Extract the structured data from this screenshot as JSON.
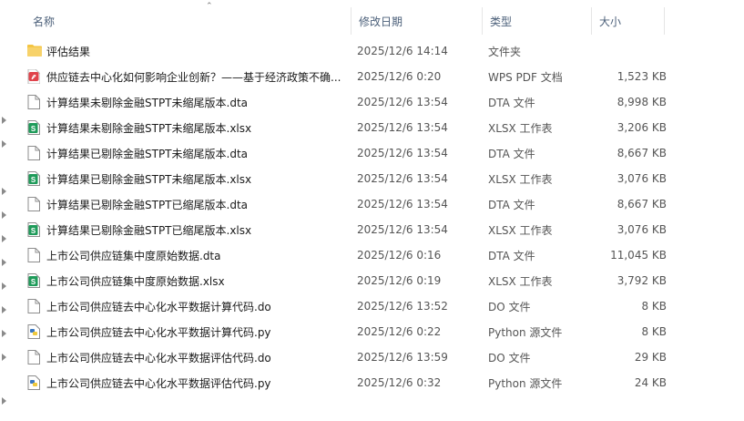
{
  "columns": {
    "name": "名称",
    "date": "修改日期",
    "type": "类型",
    "size": "大小"
  },
  "files": [
    {
      "icon": "folder-icon",
      "name": "评估结果",
      "date": "2025/12/6 14:14",
      "type": "文件夹",
      "size": ""
    },
    {
      "icon": "pdf-file-icon",
      "name": "供应链去中心化如何影响企业创新？——基于经济政策不确...",
      "date": "2025/12/6 0:20",
      "type": "WPS PDF 文档",
      "size": "1,523 KB"
    },
    {
      "icon": "document-icon",
      "name": "计算结果未剔除金融STPT未缩尾版本.dta",
      "date": "2025/12/6 13:54",
      "type": "DTA 文件",
      "size": "8,998 KB"
    },
    {
      "icon": "spreadsheet-icon",
      "name": "计算结果未剔除金融STPT未缩尾版本.xlsx",
      "date": "2025/12/6 13:54",
      "type": "XLSX 工作表",
      "size": "3,206 KB"
    },
    {
      "icon": "document-icon",
      "name": "计算结果已剔除金融STPT未缩尾版本.dta",
      "date": "2025/12/6 13:54",
      "type": "DTA 文件",
      "size": "8,667 KB"
    },
    {
      "icon": "spreadsheet-icon",
      "name": "计算结果已剔除金融STPT未缩尾版本.xlsx",
      "date": "2025/12/6 13:54",
      "type": "XLSX 工作表",
      "size": "3,076 KB"
    },
    {
      "icon": "document-icon",
      "name": "计算结果已剔除金融STPT已缩尾版本.dta",
      "date": "2025/12/6 13:54",
      "type": "DTA 文件",
      "size": "8,667 KB"
    },
    {
      "icon": "spreadsheet-icon",
      "name": "计算结果已剔除金融STPT已缩尾版本.xlsx",
      "date": "2025/12/6 13:54",
      "type": "XLSX 工作表",
      "size": "3,076 KB"
    },
    {
      "icon": "document-icon",
      "name": "上市公司供应链集中度原始数据.dta",
      "date": "2025/12/6 0:16",
      "type": "DTA 文件",
      "size": "11,045 KB"
    },
    {
      "icon": "spreadsheet-icon",
      "name": "上市公司供应链集中度原始数据.xlsx",
      "date": "2025/12/6 0:19",
      "type": "XLSX 工作表",
      "size": "3,792 KB"
    },
    {
      "icon": "document-icon",
      "name": "上市公司供应链去中心化水平数据计算代码.do",
      "date": "2025/12/6 13:52",
      "type": "DO 文件",
      "size": "8 KB"
    },
    {
      "icon": "python-file-icon",
      "name": "上市公司供应链去中心化水平数据计算代码.py",
      "date": "2025/12/6 0:22",
      "type": "Python 源文件",
      "size": "8 KB"
    },
    {
      "icon": "document-icon",
      "name": "上市公司供应链去中心化水平数据评估代码.do",
      "date": "2025/12/6 13:59",
      "type": "DO 文件",
      "size": "29 KB"
    },
    {
      "icon": "python-file-icon",
      "name": "上市公司供应链去中心化水平数据评估代码.py",
      "date": "2025/12/6 0:32",
      "type": "Python 源文件",
      "size": "24 KB"
    }
  ],
  "colors": {
    "folder": "#f4c542",
    "xlsx": "#1f9b5a",
    "pdf": "#e0434b",
    "python": "#3b78c2",
    "header_text": "#4c607a"
  }
}
